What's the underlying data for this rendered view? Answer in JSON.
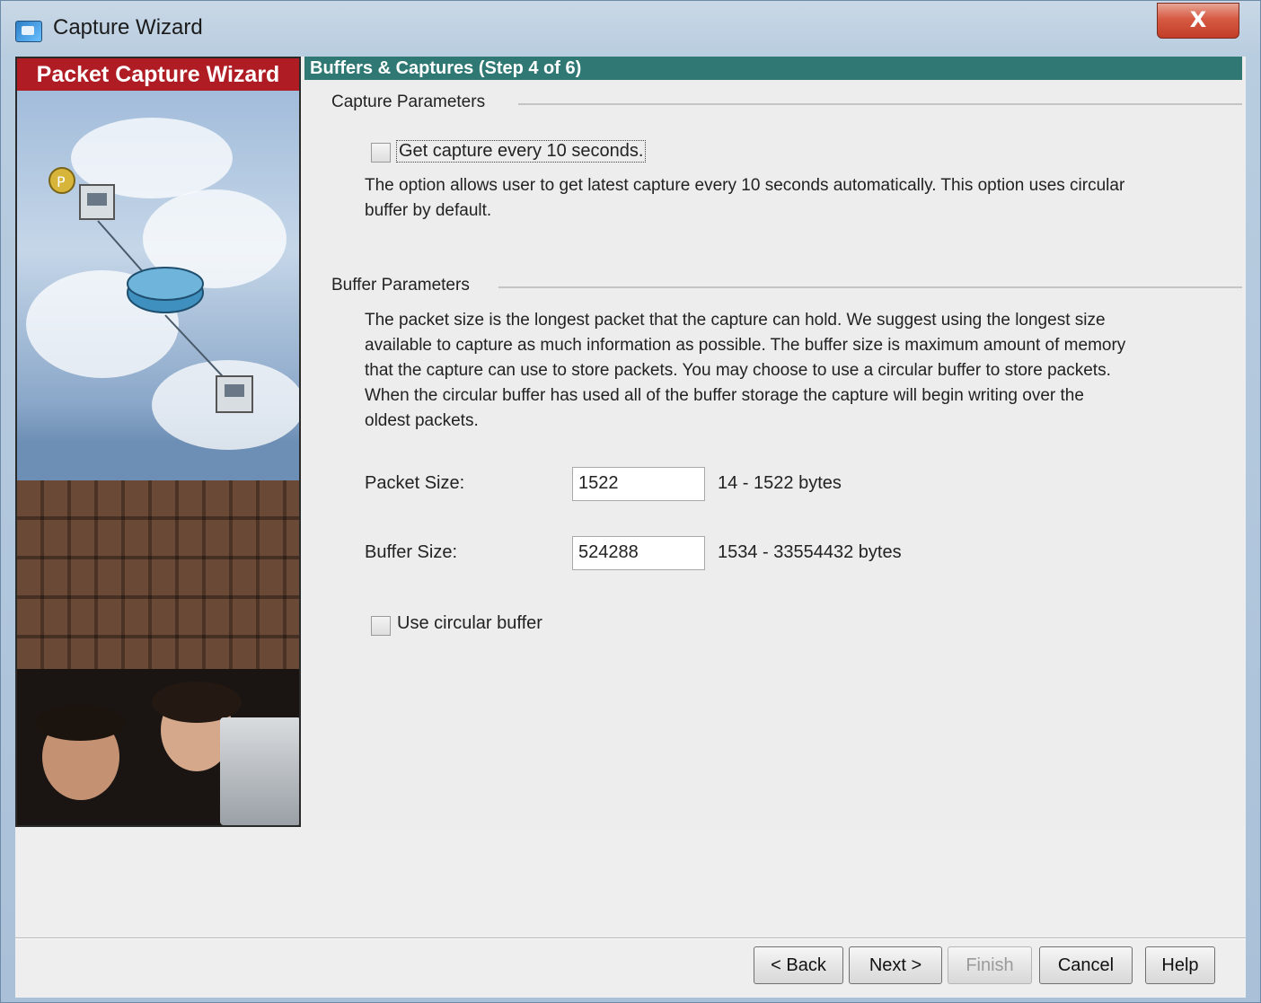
{
  "window": {
    "title": "Capture Wizard",
    "close_glyph": "X",
    "app_icon": "network-app-icon"
  },
  "left_panel": {
    "header": "Packet Capture Wizard"
  },
  "step_header": "Buffers & Captures  (Step 4 of 6)",
  "capture_params": {
    "title": "Capture Parameters",
    "checkbox_label": "Get capture every 10 seconds.",
    "checked": false,
    "description_line1": "The option allows user to get latest capture every  10 seconds automatically. This option uses circular",
    "description_line2": "buffer by default."
  },
  "buffer_params": {
    "title": "Buffer Parameters",
    "description": [
      "The packet size is the longest packet that the capture can hold. We suggest using the longest size",
      "available to capture as much information as possible. The buffer size is maximum amount of memory",
      "that the capture can use to store packets. You may choose to use a circular buffer to store packets.",
      "When the circular buffer has used all of the buffer storage the capture will begin writing over the",
      "oldest packets."
    ],
    "packet_size_label": "Packet Size:",
    "packet_size_value": "1522",
    "packet_size_range": "14 - 1522 bytes",
    "buffer_size_label": "Buffer Size:",
    "buffer_size_value": "524288",
    "buffer_size_range": "1534 - 33554432 bytes",
    "circular_label": "Use circular buffer",
    "circular_checked": false
  },
  "buttons": {
    "back": "< Back",
    "next": "Next >",
    "finish": "Finish",
    "cancel": "Cancel",
    "help": "Help"
  }
}
